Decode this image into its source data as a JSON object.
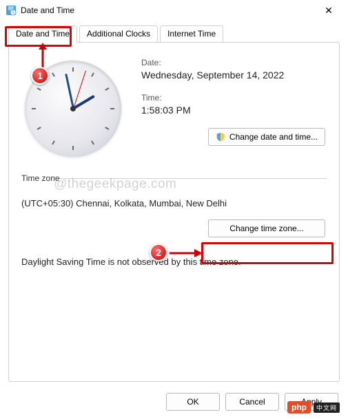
{
  "window": {
    "title": "Date and Time"
  },
  "tabs": {
    "date_time": "Date and Time",
    "additional_clocks": "Additional Clocks",
    "internet_time": "Internet Time"
  },
  "main": {
    "date_label": "Date:",
    "date_value": "Wednesday, September 14, 2022",
    "time_label": "Time:",
    "time_value": "1:58:03 PM",
    "change_dt_btn": "Change date and time...",
    "timezone_legend": "Time zone",
    "timezone_value": "(UTC+05:30) Chennai, Kolkata, Mumbai, New Delhi",
    "change_tz_btn": "Change time zone...",
    "dst_text": "Daylight Saving Time is not observed by this time zone."
  },
  "buttons": {
    "ok": "OK",
    "cancel": "Cancel",
    "apply": "Apply"
  },
  "annotations": {
    "badge1": "1",
    "badge2": "2",
    "watermark": "@thegeekpage.com",
    "overlay": "php",
    "overlay_cn": "中文网"
  }
}
